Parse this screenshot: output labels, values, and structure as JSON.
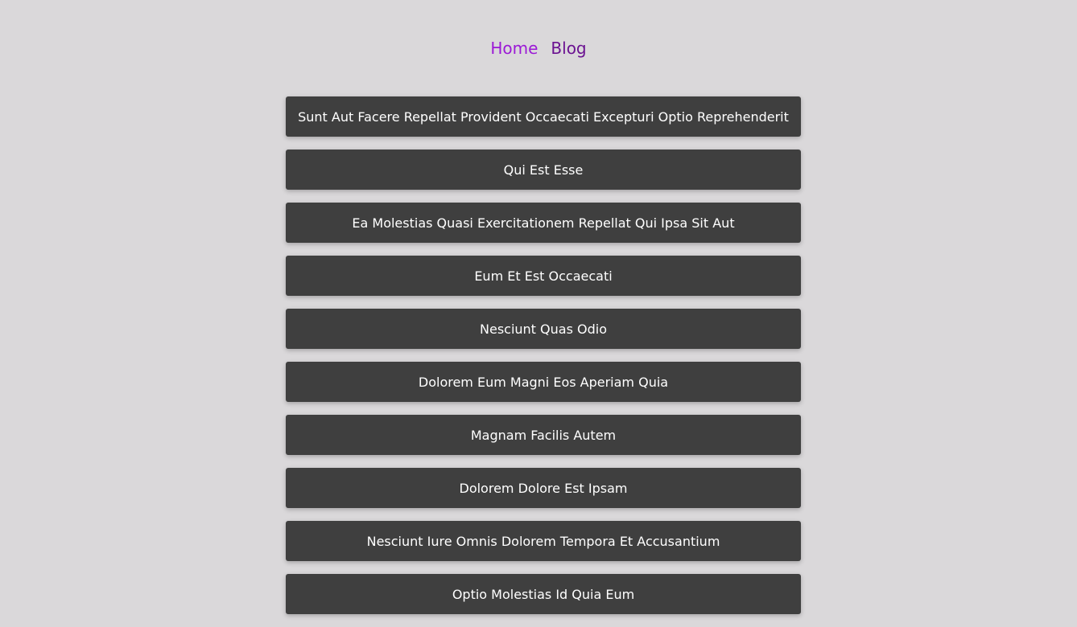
{
  "nav": {
    "home_label": "Home",
    "blog_label": "Blog"
  },
  "colors": {
    "background": "#dad8da",
    "card": "#3f3f3f",
    "home_link": "#9b19d6",
    "blog_link": "#6b1291"
  },
  "posts": [
    {
      "title": "Sunt Aut Facere Repellat Provident Occaecati Excepturi Optio Reprehenderit"
    },
    {
      "title": "Qui Est Esse"
    },
    {
      "title": "Ea Molestias Quasi Exercitationem Repellat Qui Ipsa Sit Aut"
    },
    {
      "title": "Eum Et Est Occaecati"
    },
    {
      "title": "Nesciunt Quas Odio"
    },
    {
      "title": "Dolorem Eum Magni Eos Aperiam Quia"
    },
    {
      "title": "Magnam Facilis Autem"
    },
    {
      "title": "Dolorem Dolore Est Ipsam"
    },
    {
      "title": "Nesciunt Iure Omnis Dolorem Tempora Et Accusantium"
    },
    {
      "title": "Optio Molestias Id Quia Eum"
    }
  ]
}
